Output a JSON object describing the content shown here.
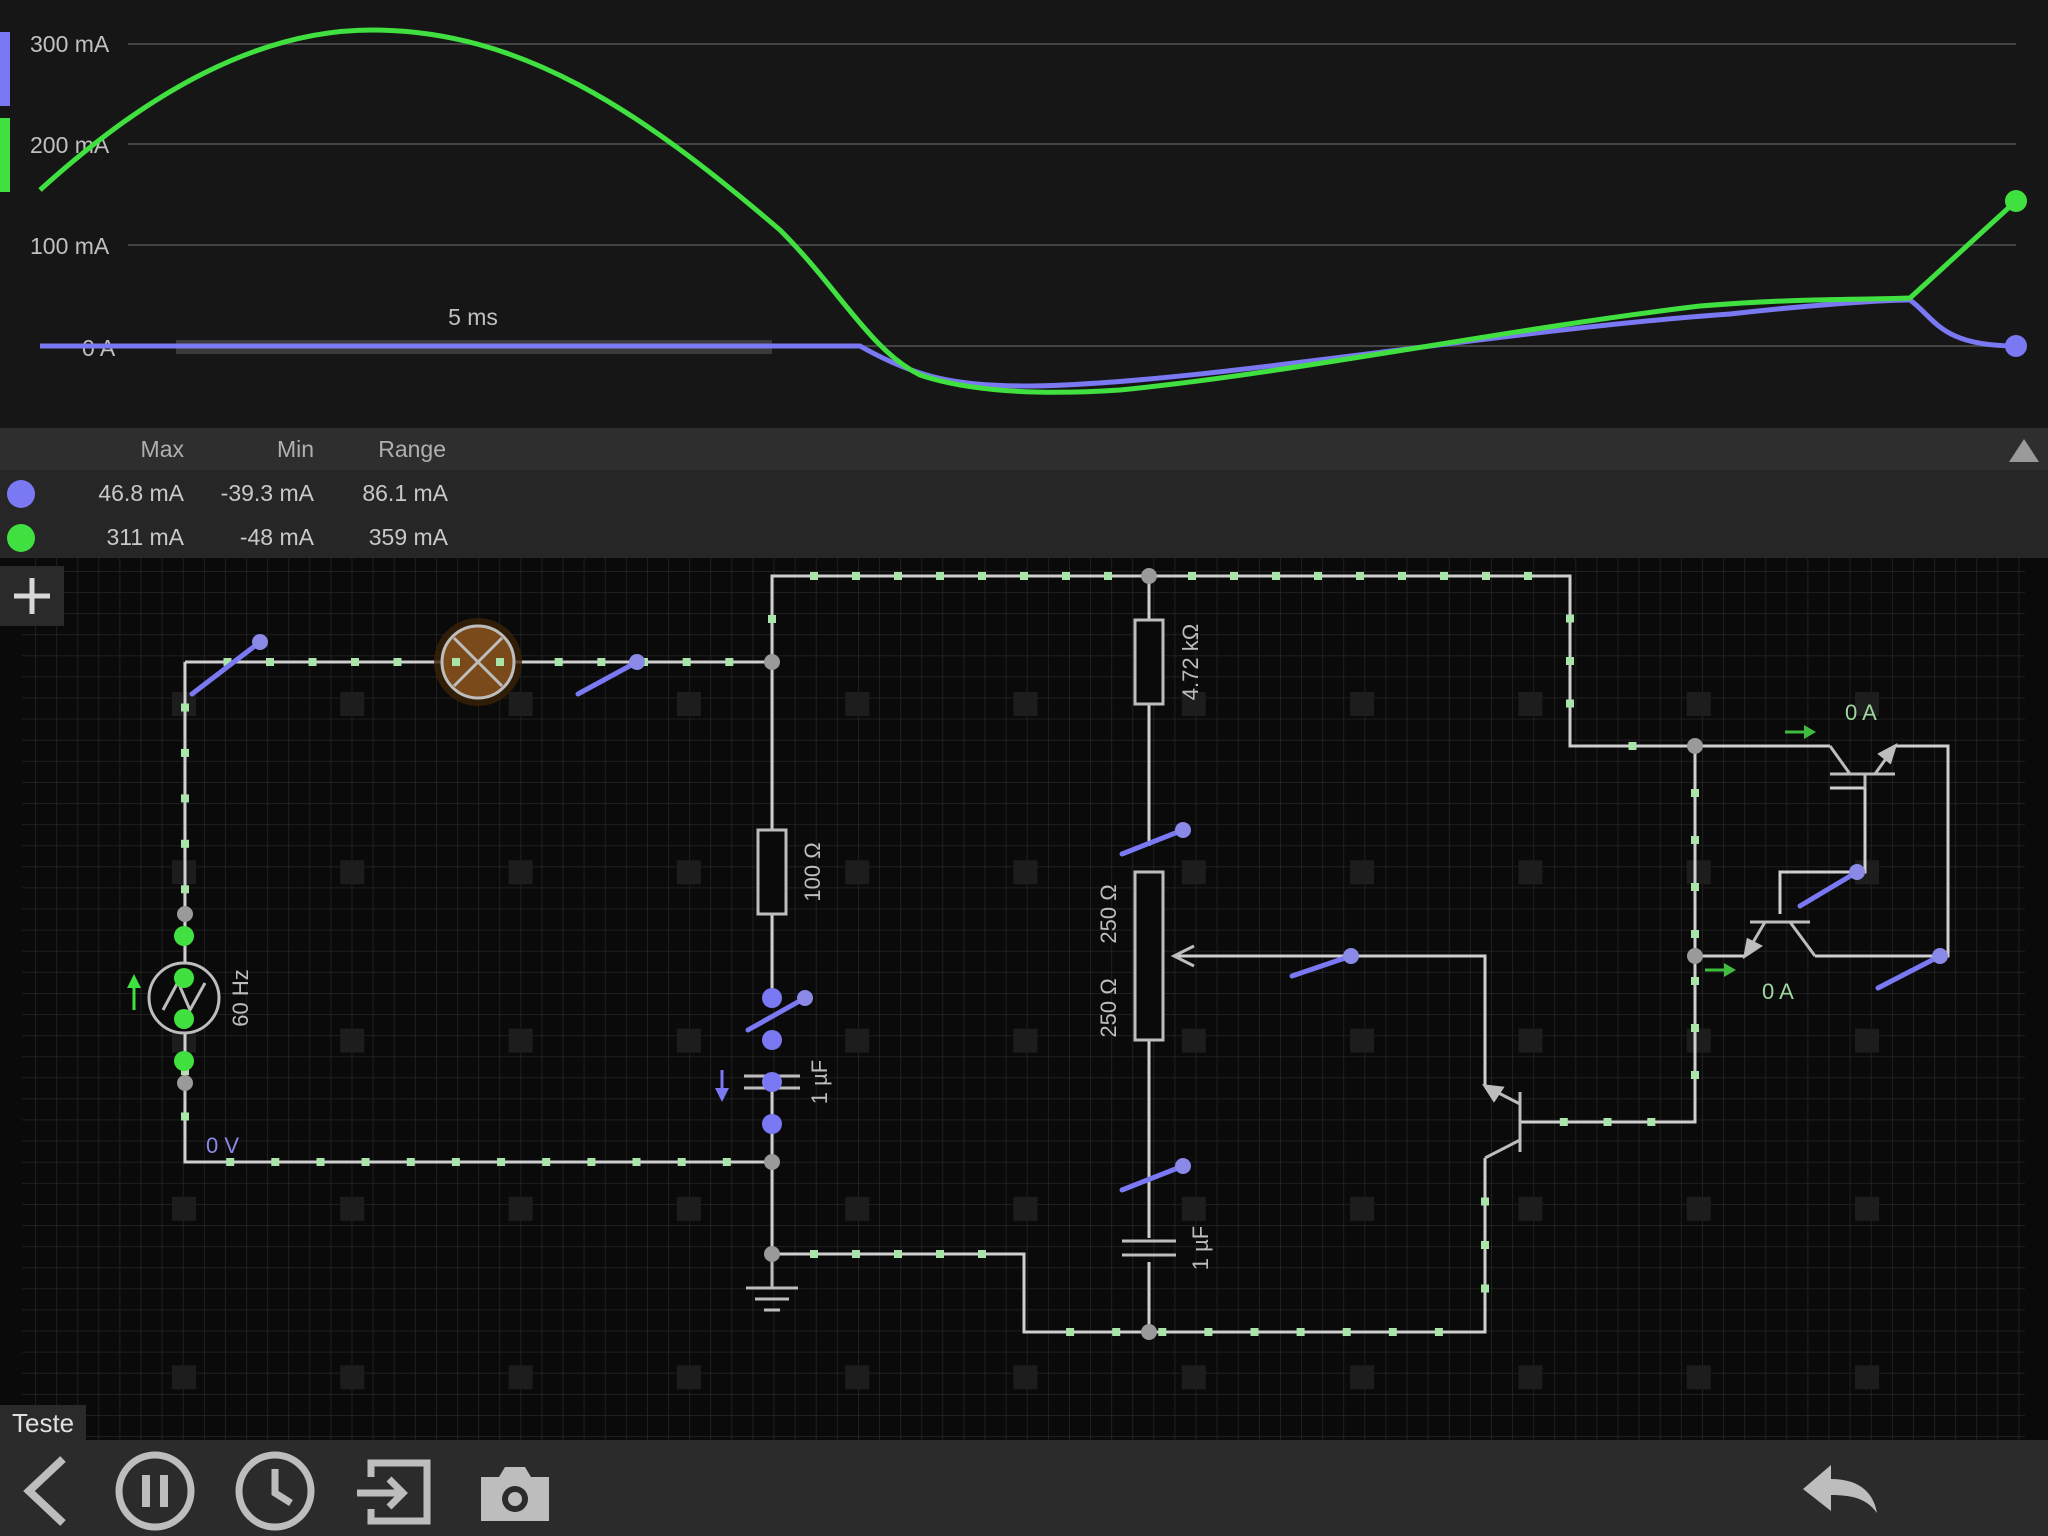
{
  "graph": {
    "y_axis_labels": [
      "300 mA",
      "200 mA",
      "100 mA",
      "0 A"
    ],
    "time_scale_label": "5 ms",
    "colors": {
      "blue": "#7a78f2",
      "green": "#3fe03f"
    }
  },
  "chart_data": {
    "type": "line",
    "title": "",
    "ylabel": "",
    "xlabel": "",
    "ylim": [
      -48,
      311
    ],
    "x_label_scale": "5 ms",
    "series": [
      {
        "color": "#7a78f2",
        "values": [
          0,
          0,
          0,
          0,
          0,
          0,
          -39.3,
          -36,
          -20,
          0,
          20,
          35,
          46.8,
          0
        ]
      },
      {
        "color": "#3fe03f",
        "values": [
          150,
          250,
          311,
          290,
          200,
          80,
          -48,
          -46,
          -30,
          -5,
          20,
          40,
          46.8,
          140
        ]
      }
    ]
  },
  "stats": {
    "headers": {
      "max": "Max",
      "min": "Min",
      "range": "Range"
    },
    "rows": [
      {
        "color": "#7a78f2",
        "max": "46.8 mA",
        "min": "-39.3 mA",
        "range": "86.1 mA"
      },
      {
        "color": "#3fe03f",
        "max": "311 mA",
        "min": "-48 mA",
        "range": "359 mA"
      }
    ]
  },
  "circuit": {
    "name": "Teste",
    "labels": {
      "source_freq": "60 Hz",
      "ground_voltage": "0 V",
      "r1": "100 Ω",
      "r2": "4.72 kΩ",
      "pot_top": "250 Ω",
      "pot_bottom": "250 Ω",
      "c1": "1 µF",
      "c2": "1 µF",
      "ammeter_top": "0 A",
      "ammeter_bottom": "0 A"
    }
  },
  "toolbar": {
    "icons": [
      "back-icon",
      "pause-icon",
      "clock-icon",
      "import-icon",
      "camera-icon",
      "undo-icon"
    ]
  }
}
